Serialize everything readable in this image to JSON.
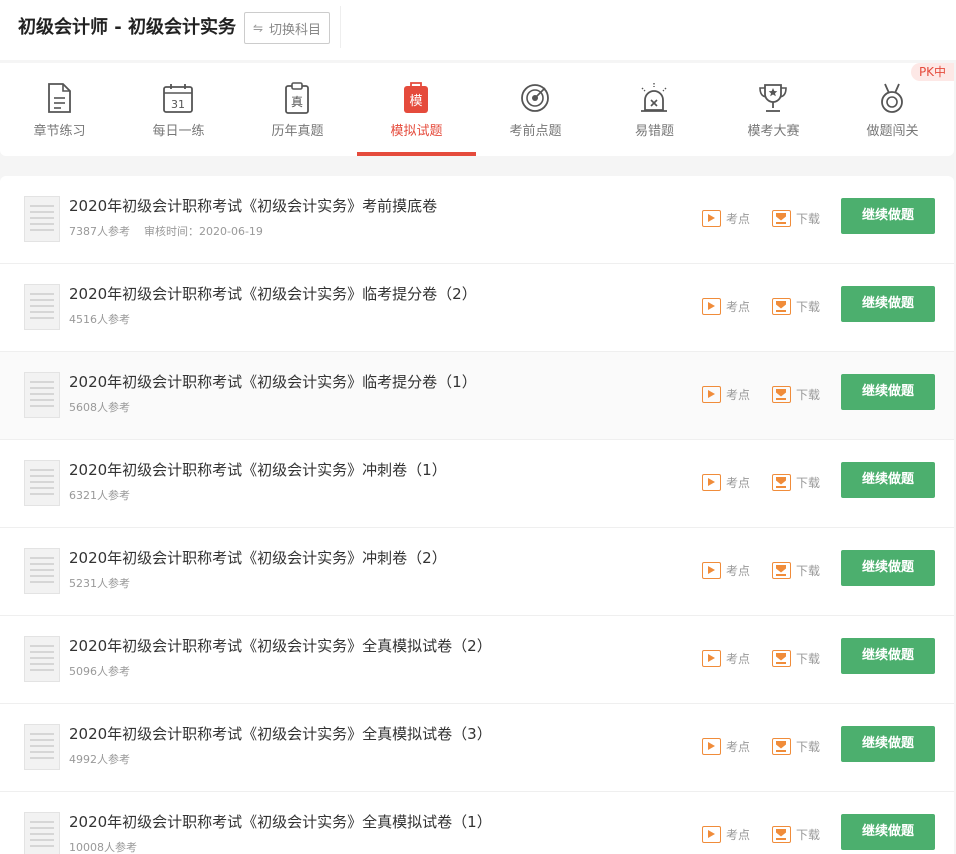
{
  "header": {
    "title": "初级会计师 - 初级会计实务",
    "switch_label": "切换科目"
  },
  "tabs": [
    {
      "label": "章节练习",
      "icon": "document-icon"
    },
    {
      "label": "每日一练",
      "icon": "calendar-icon",
      "icon_text": "31"
    },
    {
      "label": "历年真题",
      "icon": "clipboard-icon",
      "icon_text": "真"
    },
    {
      "label": "模拟试题",
      "icon": "mock-icon",
      "icon_text": "模",
      "active": true
    },
    {
      "label": "考前点题",
      "icon": "target-icon"
    },
    {
      "label": "易错题",
      "icon": "alarm-icon"
    },
    {
      "label": "模考大赛",
      "icon": "trophy-icon"
    },
    {
      "label": "做题闯关",
      "icon": "medal-icon"
    }
  ],
  "pk_badge": "PK中",
  "accent_color": "#e54b3c",
  "button_color": "#4caf6e",
  "action_color": "#f08c3a",
  "action_labels": {
    "kaodian": "考点",
    "xiazai": "下载",
    "continue": "继续做题"
  },
  "papers": [
    {
      "title": "2020年初级会计职称考试《初级会计实务》考前摸底卷",
      "participants": "7387人参考",
      "review": "审核时间：2020-06-19"
    },
    {
      "title": "2020年初级会计职称考试《初级会计实务》临考提分卷（2）",
      "participants": "4516人参考"
    },
    {
      "title": "2020年初级会计职称考试《初级会计实务》临考提分卷（1）",
      "participants": "5608人参考"
    },
    {
      "title": "2020年初级会计职称考试《初级会计实务》冲刺卷（1）",
      "participants": "6321人参考"
    },
    {
      "title": "2020年初级会计职称考试《初级会计实务》冲刺卷（2）",
      "participants": "5231人参考"
    },
    {
      "title": "2020年初级会计职称考试《初级会计实务》全真模拟试卷（2）",
      "participants": "5096人参考"
    },
    {
      "title": "2020年初级会计职称考试《初级会计实务》全真模拟试卷（3）",
      "participants": "4992人参考"
    },
    {
      "title": "2020年初级会计职称考试《初级会计实务》全真模拟试卷（1）",
      "participants": "10008人参考"
    }
  ]
}
